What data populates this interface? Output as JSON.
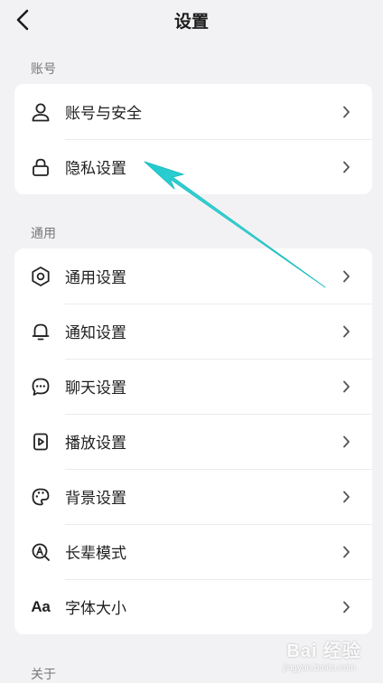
{
  "header": {
    "title": "设置"
  },
  "sections": [
    {
      "label": "账号",
      "items": [
        {
          "label": "账号与安全",
          "icon": "user-icon"
        },
        {
          "label": "隐私设置",
          "icon": "lock-icon"
        }
      ]
    },
    {
      "label": "通用",
      "items": [
        {
          "label": "通用设置",
          "icon": "gear-icon"
        },
        {
          "label": "通知设置",
          "icon": "bell-icon"
        },
        {
          "label": "聊天设置",
          "icon": "chat-bubble-icon"
        },
        {
          "label": "播放设置",
          "icon": "play-icon"
        },
        {
          "label": "背景设置",
          "icon": "palette-icon"
        },
        {
          "label": "长辈模式",
          "icon": "elder-mode-icon"
        },
        {
          "label": "字体大小",
          "icon": "font-size-icon"
        }
      ]
    },
    {
      "label": "关于",
      "items": []
    }
  ],
  "icons": {
    "font_size_glyph": "Aa"
  },
  "annotation": {
    "arrow_color": "#2fd3d6"
  },
  "watermark": {
    "text": "Bai  经验",
    "sub": "jingyan.baidu.com"
  }
}
